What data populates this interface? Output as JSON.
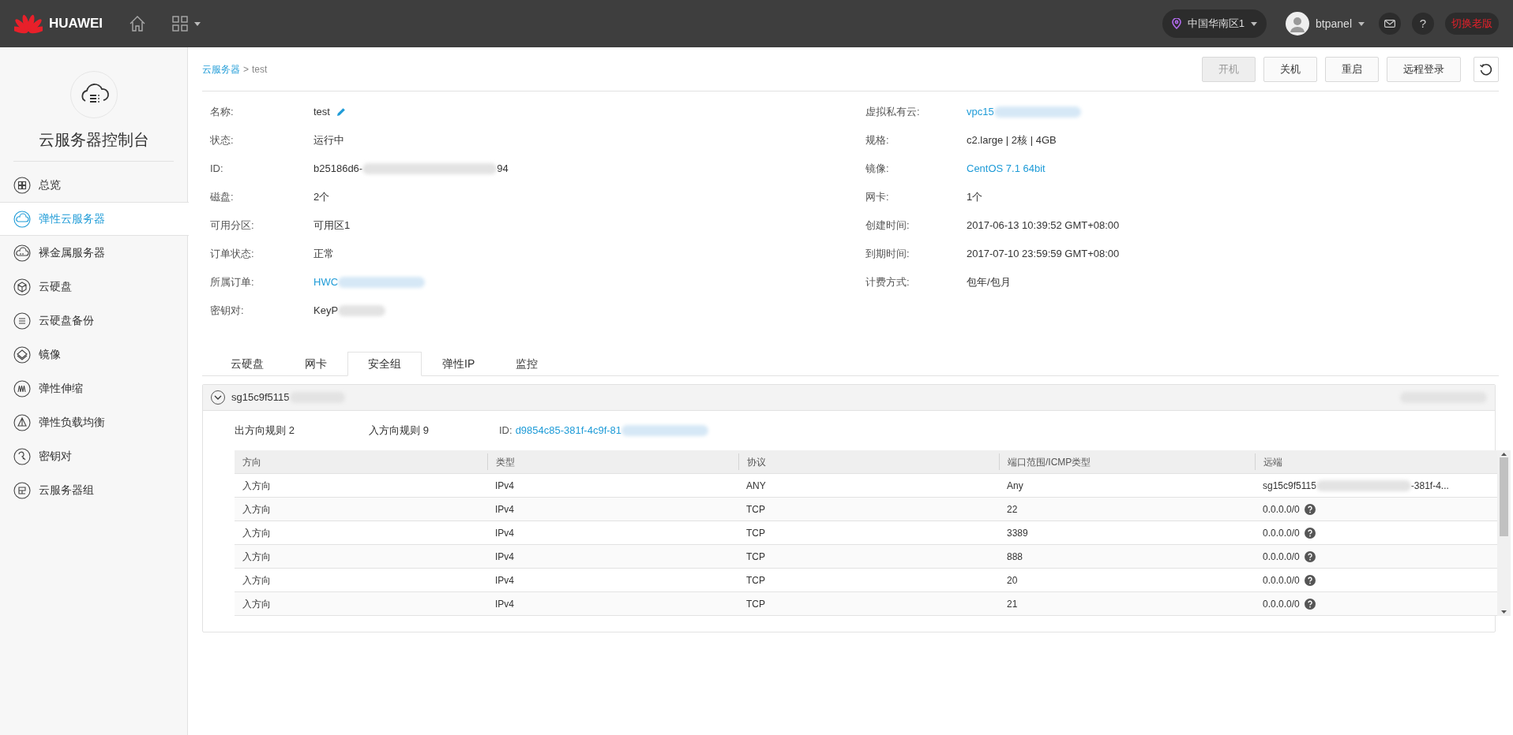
{
  "topbar": {
    "brand": "HUAWEI",
    "region": "中国华南区1",
    "user": "btpanel",
    "help": "?",
    "switch_label": "切换老版"
  },
  "sidebar": {
    "title": "云服务器控制台",
    "items": [
      {
        "label": "总览",
        "selected": false
      },
      {
        "label": "弹性云服务器",
        "selected": true
      },
      {
        "label": "裸金属服务器",
        "selected": false
      },
      {
        "label": "云硬盘",
        "selected": false
      },
      {
        "label": "云硬盘备份",
        "selected": false
      },
      {
        "label": "镜像",
        "selected": false
      },
      {
        "label": "弹性伸缩",
        "selected": false
      },
      {
        "label": "弹性负载均衡",
        "selected": false
      },
      {
        "label": "密钥对",
        "selected": false
      },
      {
        "label": "云服务器组",
        "selected": false
      }
    ]
  },
  "breadcrumb": {
    "parent": "云服务器",
    "separator": ">",
    "current": "test"
  },
  "actions": [
    {
      "label": "开机",
      "disabled": true
    },
    {
      "label": "关机",
      "disabled": false
    },
    {
      "label": "重启",
      "disabled": false
    },
    {
      "label": "远程登录",
      "disabled": false
    }
  ],
  "details_left": [
    {
      "label": "名称:",
      "parts": [
        "test"
      ],
      "kind": "editable"
    },
    {
      "label": "状态:",
      "parts": [
        "运行中"
      ],
      "kind": "text"
    },
    {
      "label": "ID:",
      "parts": [
        "b25186d6-",
        "94"
      ],
      "kind": "redacted"
    },
    {
      "label": "磁盘:",
      "parts": [
        "2个"
      ],
      "kind": "text"
    },
    {
      "label": "可用分区:",
      "parts": [
        "可用区1"
      ],
      "kind": "text"
    },
    {
      "label": "订单状态:",
      "parts": [
        "正常"
      ],
      "kind": "text"
    },
    {
      "label": "所属订单:",
      "parts": [
        "HWC"
      ],
      "kind": "redacted-link"
    },
    {
      "label": "密钥对:",
      "parts": [
        "KeyP"
      ],
      "kind": "redacted"
    }
  ],
  "details_right": [
    {
      "label": "虚拟私有云:",
      "parts": [
        "vpc15"
      ],
      "kind": "redacted-link"
    },
    {
      "label": "规格:",
      "parts": [
        "c2.large | 2核 | 4GB"
      ],
      "kind": "text"
    },
    {
      "label": "镜像:",
      "parts": [
        "CentOS 7.1 64bit"
      ],
      "kind": "link"
    },
    {
      "label": "网卡:",
      "parts": [
        "1个"
      ],
      "kind": "text"
    },
    {
      "label": "创建时间:",
      "parts": [
        "2017-06-13 10:39:52 GMT+08:00"
      ],
      "kind": "text"
    },
    {
      "label": "到期时间:",
      "parts": [
        "2017-07-10 23:59:59 GMT+08:00"
      ],
      "kind": "text"
    },
    {
      "label": "计费方式:",
      "parts": [
        "包年/包月"
      ],
      "kind": "text"
    }
  ],
  "tabs": [
    {
      "label": "云硬盘",
      "selected": false
    },
    {
      "label": "网卡",
      "selected": false
    },
    {
      "label": "安全组",
      "selected": true
    },
    {
      "label": "弹性IP",
      "selected": false
    },
    {
      "label": "监控",
      "selected": false
    }
  ],
  "security_group": {
    "name": "sg15c9f5115",
    "expanded": true,
    "outbound_label": "出方向规则",
    "outbound_count": "2",
    "inbound_label": "入方向规则",
    "inbound_count": "9",
    "id_label": "ID:",
    "id_value": "d9854c85-381f-4c9f-81",
    "table": {
      "columns": [
        "方向",
        "类型",
        "协议",
        "端口范围/ICMP类型",
        "远端"
      ],
      "rows": [
        {
          "cells": [
            "入方向",
            "IPv4",
            "ANY",
            "Any"
          ],
          "remote": [
            "sg15c9f5115",
            "-381f-4..."
          ],
          "kind": "group"
        },
        {
          "cells": [
            "入方向",
            "IPv4",
            "TCP",
            "22"
          ],
          "remote": [
            "0.0.0.0/0"
          ],
          "kind": "cidr"
        },
        {
          "cells": [
            "入方向",
            "IPv4",
            "TCP",
            "3389"
          ],
          "remote": [
            "0.0.0.0/0"
          ],
          "kind": "cidr"
        },
        {
          "cells": [
            "入方向",
            "IPv4",
            "TCP",
            "888"
          ],
          "remote": [
            "0.0.0.0/0"
          ],
          "kind": "cidr"
        },
        {
          "cells": [
            "入方向",
            "IPv4",
            "TCP",
            "20"
          ],
          "remote": [
            "0.0.0.0/0"
          ],
          "kind": "cidr"
        },
        {
          "cells": [
            "入方向",
            "IPv4",
            "TCP",
            "21"
          ],
          "remote": [
            "0.0.0.0/0"
          ],
          "kind": "cidr"
        }
      ]
    }
  }
}
